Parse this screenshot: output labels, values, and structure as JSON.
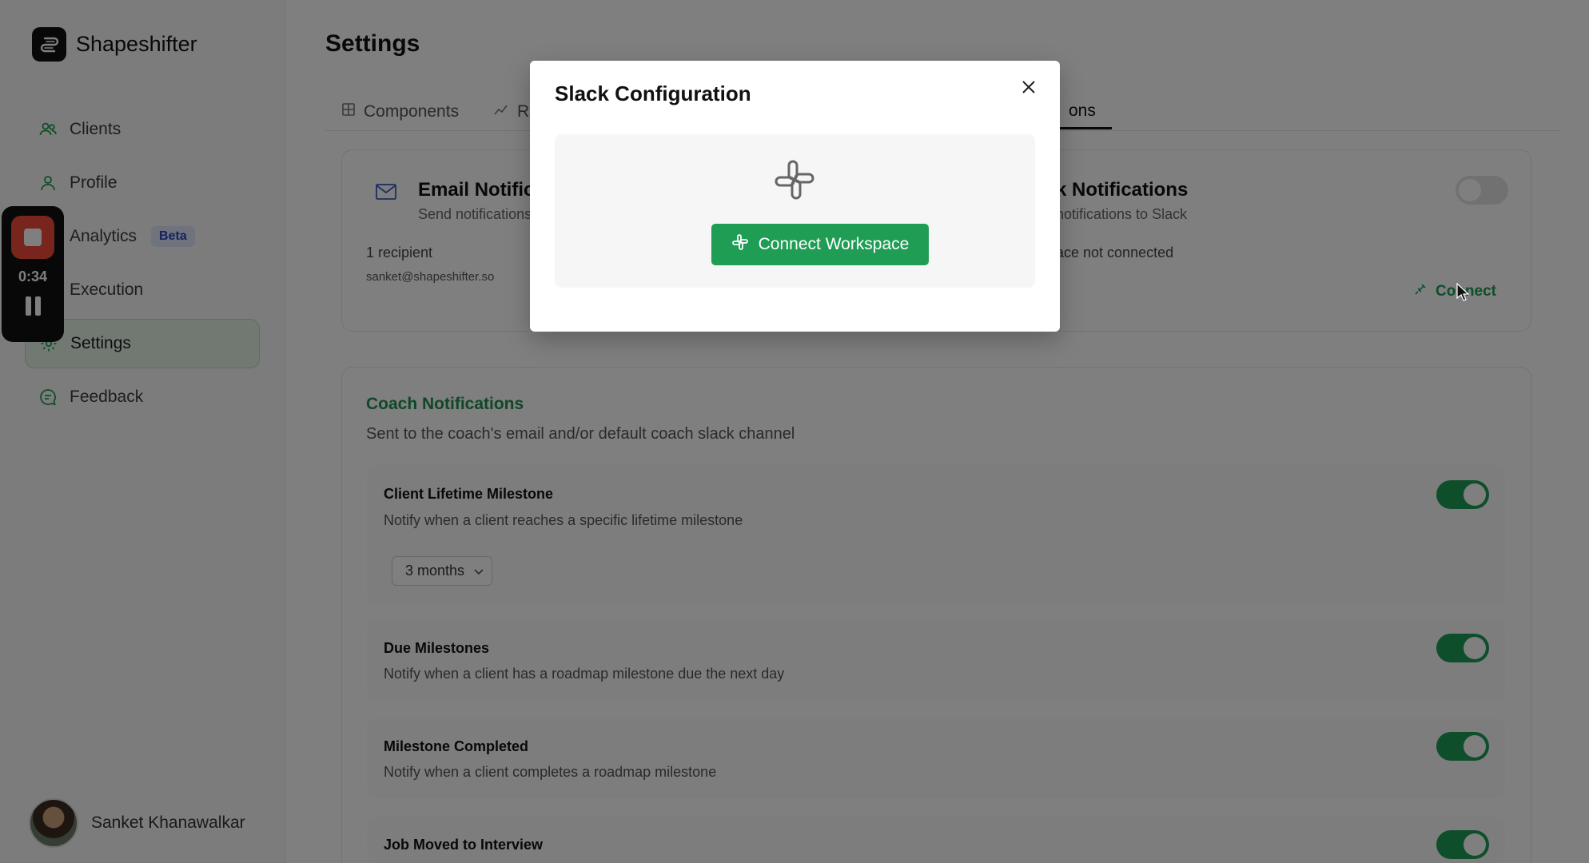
{
  "app": {
    "name": "Shapeshifter",
    "user_name": "Sanket Khanawalkar"
  },
  "sidebar": {
    "items": [
      {
        "label": "Clients",
        "icon": "users-icon"
      },
      {
        "label": "Profile",
        "icon": "user-icon"
      },
      {
        "label": "Analytics",
        "icon": "chart-icon",
        "badge": "Beta"
      },
      {
        "label": "Execution",
        "icon": "play-icon"
      },
      {
        "label": "Settings",
        "icon": "gear-icon",
        "active": true
      },
      {
        "label": "Feedback",
        "icon": "message-icon"
      }
    ]
  },
  "recorder": {
    "time": "0:34"
  },
  "page": {
    "title": "Settings",
    "tabs": [
      {
        "label": "Components"
      },
      {
        "label": "R"
      },
      {
        "label": "ons",
        "active": true
      }
    ]
  },
  "email_card": {
    "title": "Email Notific",
    "subtitle": "Send notifications",
    "recipients": "1 recipient",
    "email": "sanket@shapeshifter.so"
  },
  "slack_card": {
    "title": "k Notifications",
    "subtitle": "notifications to Slack",
    "status": "ace not connected",
    "connect_label": "Connect",
    "enabled": false
  },
  "coach": {
    "title": "Coach Notifications",
    "subtitle": "Sent to the coach's email and/or default coach slack channel",
    "items": [
      {
        "title": "Client Lifetime Milestone",
        "desc": "Notify when a client reaches a specific lifetime milestone",
        "enabled": true,
        "select": "3 months"
      },
      {
        "title": "Due Milestones",
        "desc": "Notify when a client has a roadmap milestone due the next day",
        "enabled": true
      },
      {
        "title": "Milestone Completed",
        "desc": "Notify when a client completes a roadmap milestone",
        "enabled": true
      },
      {
        "title": "Job Moved to Interview",
        "desc": "",
        "enabled": true
      }
    ]
  },
  "modal": {
    "title": "Slack Configuration",
    "button_label": "Connect Workspace"
  },
  "colors": {
    "accent": "#1f9d55",
    "coach_title": "#1f8f4e"
  }
}
